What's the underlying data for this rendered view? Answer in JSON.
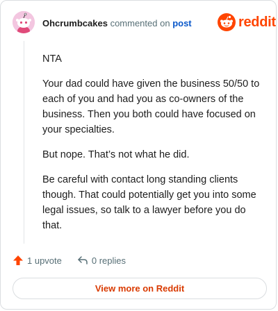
{
  "comment": {
    "username": "Ohcrumbcakes",
    "commented_on_text": "commented on",
    "post_link": "post",
    "paragraphs": [
      "NTA",
      "Your dad could have given the business 50/50 to each of you and had you as co-owners of the business. Then you both could have focused on your specialties.",
      "But nope. That’s not what he did.",
      "Be careful with contact long standing clients though. That could potentially get you into some legal issues, so talk to a lawyer before you do that."
    ]
  },
  "brand": {
    "wordmark": "reddit",
    "color": "#ff4500"
  },
  "actions": {
    "upvotes": "1 upvote",
    "replies": "0 replies"
  },
  "footer": {
    "view_more": "View more on Reddit"
  },
  "icons": [
    "snoo-avatar-icon",
    "reddit-logo-icon",
    "upvote-arrow-icon",
    "reply-arrow-icon"
  ]
}
